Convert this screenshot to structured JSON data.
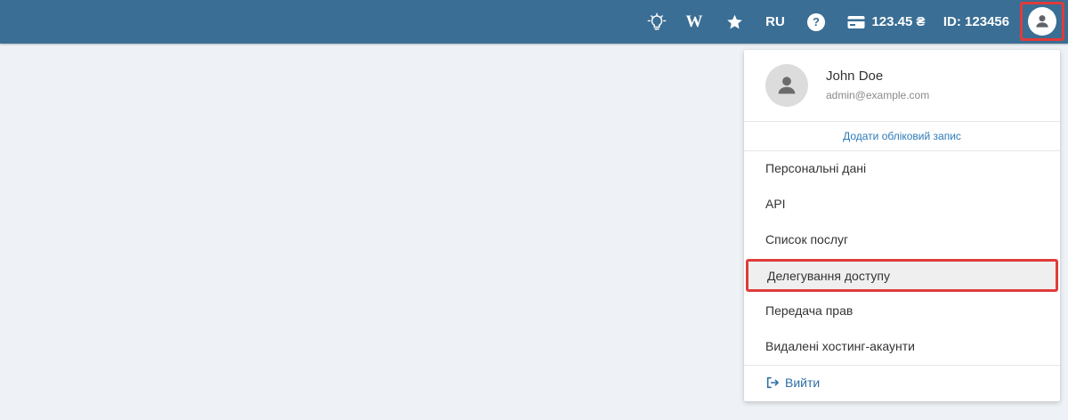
{
  "topbar": {
    "idea_icon": "lightbulb-icon",
    "wiki_label": "W",
    "favorites_icon": "star-icon",
    "language": "RU",
    "help_label": "?",
    "balance_icon": "credit-card-icon",
    "balance": "123.45 ₴",
    "account_id": "ID: 123456",
    "avatar_icon": "user-avatar-icon"
  },
  "dropdown": {
    "user_name": "John Doe",
    "user_email": "admin@example.com",
    "add_account": "Додати обліковий запис",
    "items": [
      {
        "label": "Персональні дані"
      },
      {
        "label": "API"
      },
      {
        "label": "Список послуг"
      },
      {
        "label": "Делегування доступу",
        "highlighted": true
      },
      {
        "label": "Передача прав"
      },
      {
        "label": "Видалені хостинг-акаунти"
      }
    ],
    "logout": "Вийти"
  },
  "colors": {
    "topbar": "#3a6e94",
    "background": "#eef2f6",
    "link": "#2d7ab8",
    "highlight_border": "#e03b3b"
  }
}
